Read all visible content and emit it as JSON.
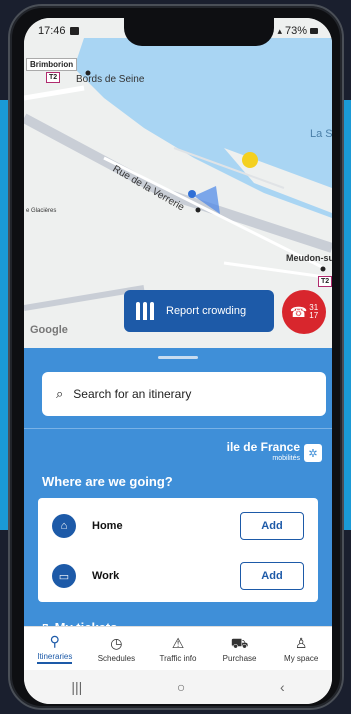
{
  "statusbar": {
    "time": "17:46",
    "battery": "73%"
  },
  "map": {
    "place_brimborion": "Brimborion",
    "t2_label": "T2",
    "street_bords": "Bords de Seine",
    "street_verrerie": "Rue de la Verrerie",
    "river_label": "La Se",
    "glacieres": "e Glacières",
    "meudon": "Meudon-su",
    "google": "Google"
  },
  "actions": {
    "report_crowding": "Report crowding",
    "sos_top": "31",
    "sos_bottom": "17"
  },
  "sheet": {
    "search_placeholder": "Search for an itinerary",
    "brand_main": "ile de France",
    "brand_sub": "mobilités",
    "question": "Where are we going?",
    "places": [
      {
        "label": "Home",
        "action": "Add"
      },
      {
        "label": "Work",
        "action": "Add"
      }
    ],
    "tickets": "My tickets"
  },
  "nav": {
    "items": [
      {
        "label": "Itineraries",
        "icon": "location-pin-icon"
      },
      {
        "label": "Schedules",
        "icon": "clock-icon"
      },
      {
        "label": "Traffic info",
        "icon": "warning-icon"
      },
      {
        "label": "Purchase",
        "icon": "cart-icon"
      },
      {
        "label": "My space",
        "icon": "person-icon"
      }
    ],
    "active": "Itineraries"
  },
  "colors": {
    "accent": "#1d5aa8",
    "sheet": "#3f8fd8",
    "sos": "#d8262d"
  }
}
